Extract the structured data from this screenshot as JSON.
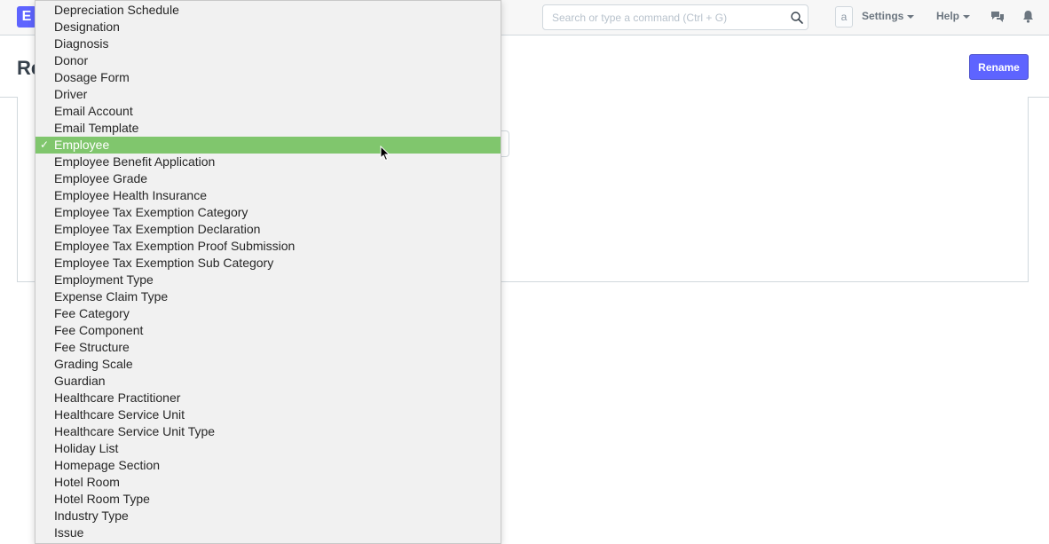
{
  "app": {
    "logo_letter": "E"
  },
  "navbar": {
    "search_placeholder": "Search or type a command (Ctrl + G)",
    "avatar_letter": "a",
    "settings_label": "Settings",
    "help_label": "Help"
  },
  "page": {
    "title_visible": "Re",
    "rename_label": "Rename"
  },
  "dropdown": {
    "options": [
      "Depreciation Schedule",
      "Designation",
      "Diagnosis",
      "Donor",
      "Dosage Form",
      "Driver",
      "Email Account",
      "Email Template",
      "Employee",
      "Employee Benefit Application",
      "Employee Grade",
      "Employee Health Insurance",
      "Employee Tax Exemption Category",
      "Employee Tax Exemption Declaration",
      "Employee Tax Exemption Proof Submission",
      "Employee Tax Exemption Sub Category",
      "Employment Type",
      "Expense Claim Type",
      "Fee Category",
      "Fee Component",
      "Fee Structure",
      "Grading Scale",
      "Guardian",
      "Healthcare Practitioner",
      "Healthcare Service Unit",
      "Healthcare Service Unit Type",
      "Holiday List",
      "Homepage Section",
      "Hotel Room",
      "Hotel Room Type",
      "Industry Type",
      "Issue"
    ],
    "selected_value": "Employee",
    "check_glyph": "✓"
  },
  "colors": {
    "brand": "#5e64ff",
    "selected_highlight": "#80c66d",
    "dropdown_bg": "#f1f1f1",
    "navbar_bg": "#f7f7f7"
  },
  "icons": [
    "search-icon",
    "chat-icon",
    "bell-icon",
    "checkmark-icon",
    "mouse-cursor-icon"
  ]
}
